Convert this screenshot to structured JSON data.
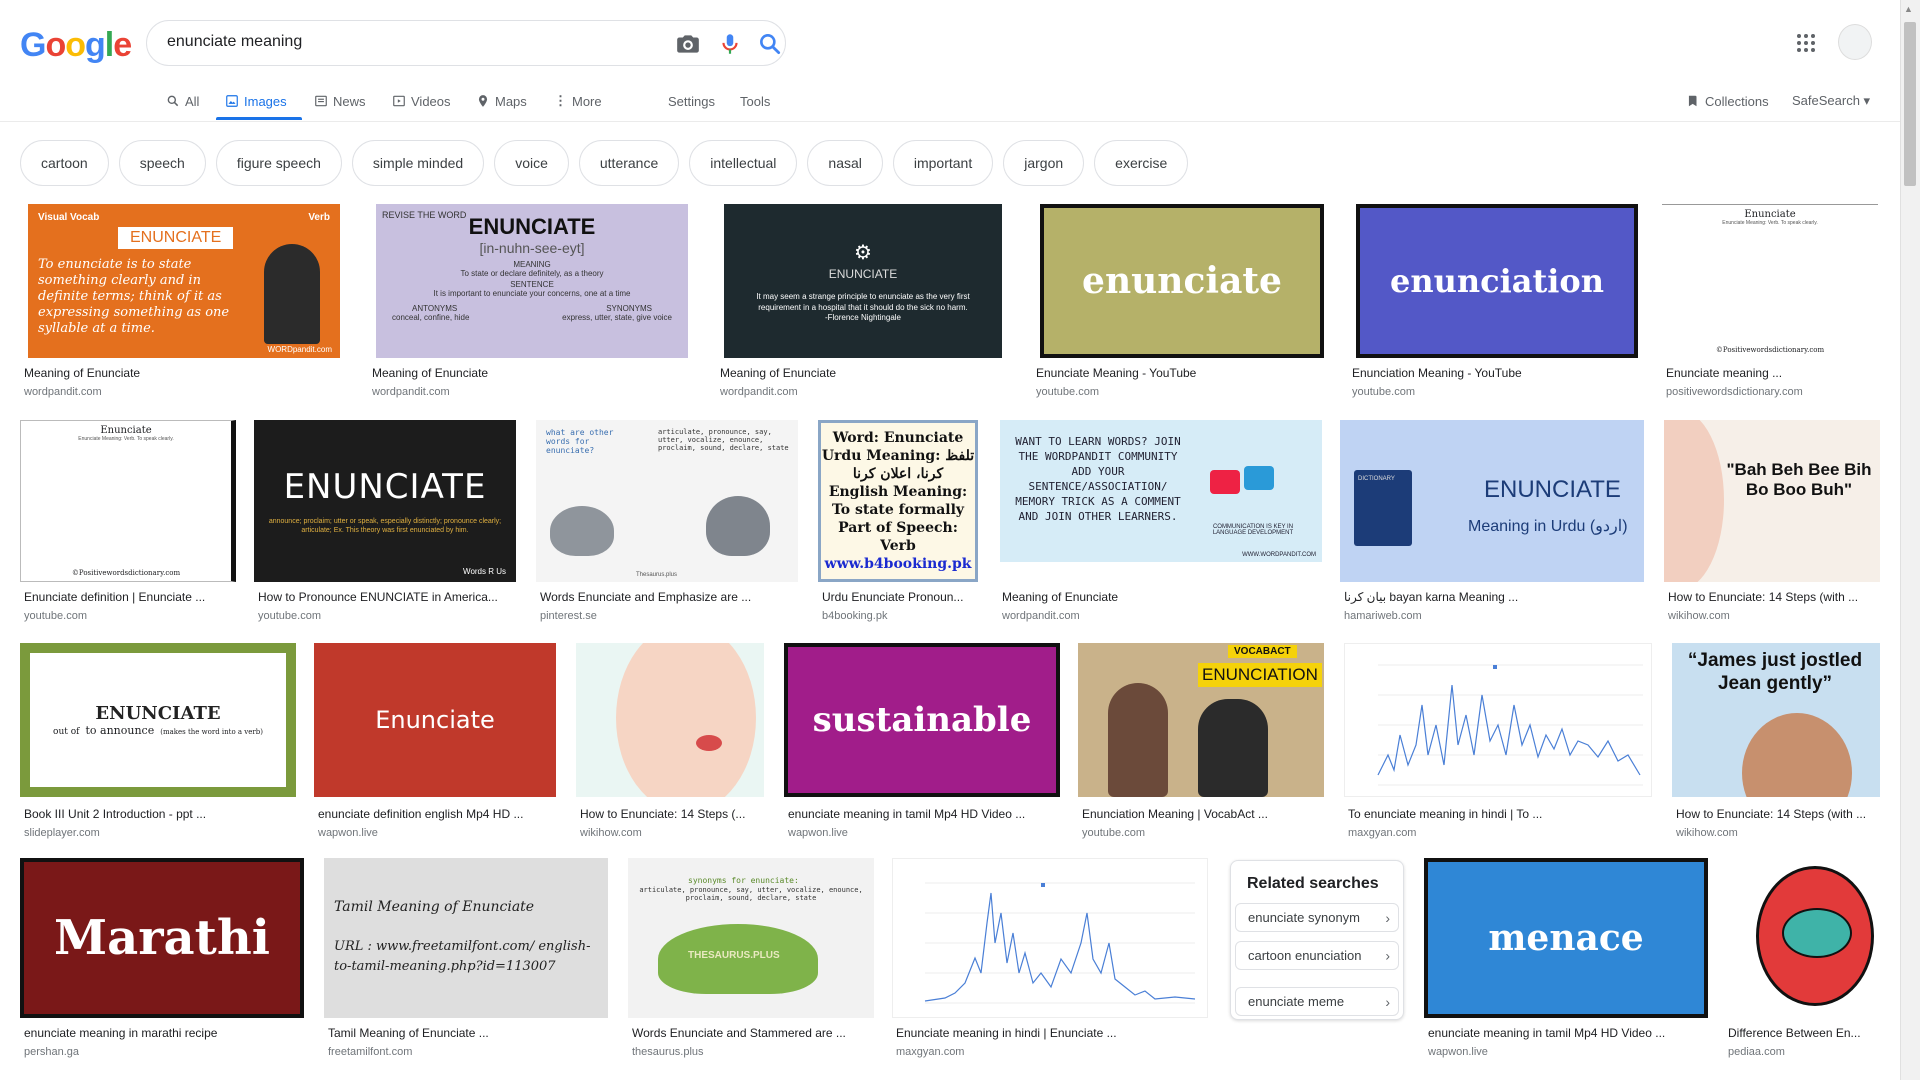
{
  "header": {
    "logo": "Google",
    "search_value": "enunciate meaning",
    "icons": [
      "camera-icon",
      "mic-icon",
      "search-icon",
      "apps-icon"
    ]
  },
  "nav": {
    "tabs": [
      "All",
      "Images",
      "News",
      "Videos",
      "Maps",
      "More"
    ],
    "settings": "Settings",
    "tools": "Tools",
    "collections": "Collections",
    "safesearch": "SafeSearch ▾",
    "active_tab": "Images"
  },
  "chips": [
    "cartoon",
    "speech",
    "figure speech",
    "simple minded",
    "voice",
    "utterance",
    "intellectual",
    "nasal",
    "important",
    "jargon",
    "exercise"
  ],
  "results": [
    {
      "caption": "Meaning of Enunciate",
      "source": "wordpandit.com",
      "thumb": {
        "line1": "Visual Vocab",
        "line2": "ENUNCIATE",
        "line3": "Verb",
        "line4": "To enunciate is to state something clearly and in definite terms; think of it as expressing something as one syllable at a time.",
        "line5": "WORDpandit.com"
      }
    },
    {
      "caption": "Meaning of Enunciate",
      "source": "wordpandit.com",
      "thumb": {
        "line1": "REVISE THE WORD",
        "line2": "ENUNCIATE",
        "line3": "[in-nuhn-see-eyt]",
        "line4": "MEANING",
        "line5": "To state or declare definitely, as a theory",
        "line6": "SENTENCE",
        "line7": "It is important to enunciate your concerns, one at a time",
        "line8": "ANTONYMS",
        "line9": "conceal, confine, hide",
        "line10": "SYNONYMS",
        "line11": "express, utter, state, give voice"
      }
    },
    {
      "caption": "Meaning of Enunciate",
      "source": "wordpandit.com",
      "thumb": {
        "line1": "ENUNCIATE",
        "line2": "It may seem a strange principle to enunciate as the very first requirement in a hospital that it should do the sick no harm.",
        "line3": "-Florence Nightingale"
      }
    },
    {
      "caption": "Enunciate Meaning - YouTube",
      "source": "youtube.com",
      "thumb": {
        "line1": "enunciate"
      }
    },
    {
      "caption": "Enunciation Meaning - YouTube",
      "source": "youtube.com",
      "thumb": {
        "line1": "enunciation"
      }
    },
    {
      "caption": "Enunciate meaning ...",
      "source": "positivewordsdictionary.com",
      "thumb": {
        "line1": "Enunciate",
        "line2": "Enunciate Meaning: Verb. To speak clearly.",
        "line3": "©Positivewordsdictionary.com"
      }
    },
    {
      "caption": "Enunciate definition | Enunciate ...",
      "source": "youtube.com",
      "thumb": {
        "line1": "Enunciate",
        "line2": "Enunciate Meaning: Verb. To speak clearly.",
        "line3": "©Positivewordsdictionary.com"
      }
    },
    {
      "caption": "How to Pronounce ENUNCIATE in America...",
      "source": "youtube.com",
      "thumb": {
        "line1": "ENUNCIATE",
        "line2": "announce; proclaim; utter or speak, especially distinctly; pronounce clearly; articulate; Ex. This theory was first enunciated by him.",
        "line3": "Words R Us"
      }
    },
    {
      "caption": "Words Enunciate and Emphasize are ...",
      "source": "pinterest.se",
      "thumb": {
        "line1": "what are other words for enunciate?",
        "line2": "articulate, pronounce, say, utter, vocalize, enounce, proclaim, sound, declare, state",
        "line3": "Thesaurus.plus"
      }
    },
    {
      "caption": "Urdu Enunciate Pronoun...",
      "source": "b4booking.pk",
      "thumb": {
        "line1": "Word: Enunciate",
        "line2": "Urdu Meaning: تلفظ کرنا، اعلان کرنا",
        "line3": "English Meaning: To state formally",
        "line4": "Part of Speech: Verb",
        "line5": "www.b4booking.pk"
      }
    },
    {
      "caption": "Meaning of Enunciate",
      "source": "wordpandit.com",
      "thumb": {
        "line1": "WANT TO LEARN WORDS? JOIN THE WORDPANDIT COMMUNITY ADD YOUR SENTENCE/ASSOCIATION/ MEMORY TRICK AS A COMMENT AND JOIN OTHER LEARNERS.",
        "line2": "COMMUNICATION IS KEY IN LANGUAGE DEVELOPMENT",
        "line3": "WWW.WORDPANDIT.COM"
      }
    },
    {
      "caption": "بیان کرنا bayan karna Meaning ...",
      "source": "hamariweb.com",
      "thumb": {
        "line1": "ENUNCIATE",
        "line2": "Meaning in Urdu (اردو)",
        "line3": "DICTIONARY"
      }
    },
    {
      "caption": "How to Enunciate: 14 Steps (with ...",
      "source": "wikihow.com",
      "thumb": {
        "line1": "\"Bah Beh Bee Bih Bo Boo Buh\""
      }
    },
    {
      "caption": "Book III Unit 2 Introduction - ppt ...",
      "source": "slideplayer.com",
      "thumb": {
        "line1": "ENUNCIATE",
        "line2": "out of",
        "line3": "to announce",
        "line4": "(makes the word into a verb)"
      }
    },
    {
      "caption": "enunciate definition english Mp4 HD ...",
      "source": "wapwon.live",
      "thumb": {
        "line1": "Enunciate"
      }
    },
    {
      "caption": "How to Enunciate: 14 Steps (...",
      "source": "wikihow.com",
      "thumb": {}
    },
    {
      "caption": "enunciate meaning in tamil Mp4 HD Video ...",
      "source": "wapwon.live",
      "thumb": {
        "line1": "sustainable"
      }
    },
    {
      "caption": "Enunciation Meaning | VocabAct ...",
      "source": "youtube.com",
      "thumb": {
        "line1": "ENUNCIATION",
        "line2": "VOCABACT"
      }
    },
    {
      "caption": "To enunciate meaning in hindi | To ...",
      "source": "maxgyan.com",
      "thumb": {}
    },
    {
      "caption": "How to Enunciate: 14 Steps (with ...",
      "source": "wikihow.com",
      "thumb": {
        "line1": "“James just jostled Jean gently”"
      }
    },
    {
      "caption": "enunciate meaning in marathi recipe",
      "source": "pershan.ga",
      "thumb": {
        "line1": "Marathi"
      }
    },
    {
      "caption": "Tamil Meaning of Enunciate ...",
      "source": "freetamilfont.com",
      "thumb": {
        "line1": "Tamil Meaning of Enunciate",
        "line2": "URL : www.freetamilfont.com/ english-to-tamil-meaning.php?id=113007"
      }
    },
    {
      "caption": "Words Enunciate and Stammered are ...",
      "source": "thesaurus.plus",
      "thumb": {
        "line1": "synonyms for enunciate:",
        "line2": "articulate, pronounce, say, utter, vocalize, enounce, proclaim, sound, declare, state",
        "line3": "THESAURUS.PLUS"
      }
    },
    {
      "caption": "Enunciate meaning in hindi | Enunciate ...",
      "source": "maxgyan.com",
      "thumb": {}
    },
    {
      "caption": "enunciate meaning in tamil Mp4 HD Video ...",
      "source": "wapwon.live",
      "thumb": {
        "line1": "menace"
      }
    },
    {
      "caption": "Difference Between En...",
      "source": "pediaa.com",
      "thumb": {}
    }
  ],
  "related": {
    "title": "Related searches",
    "items": [
      "enunciate synonym",
      "cartoon enunciation",
      "enunciate meme"
    ]
  }
}
